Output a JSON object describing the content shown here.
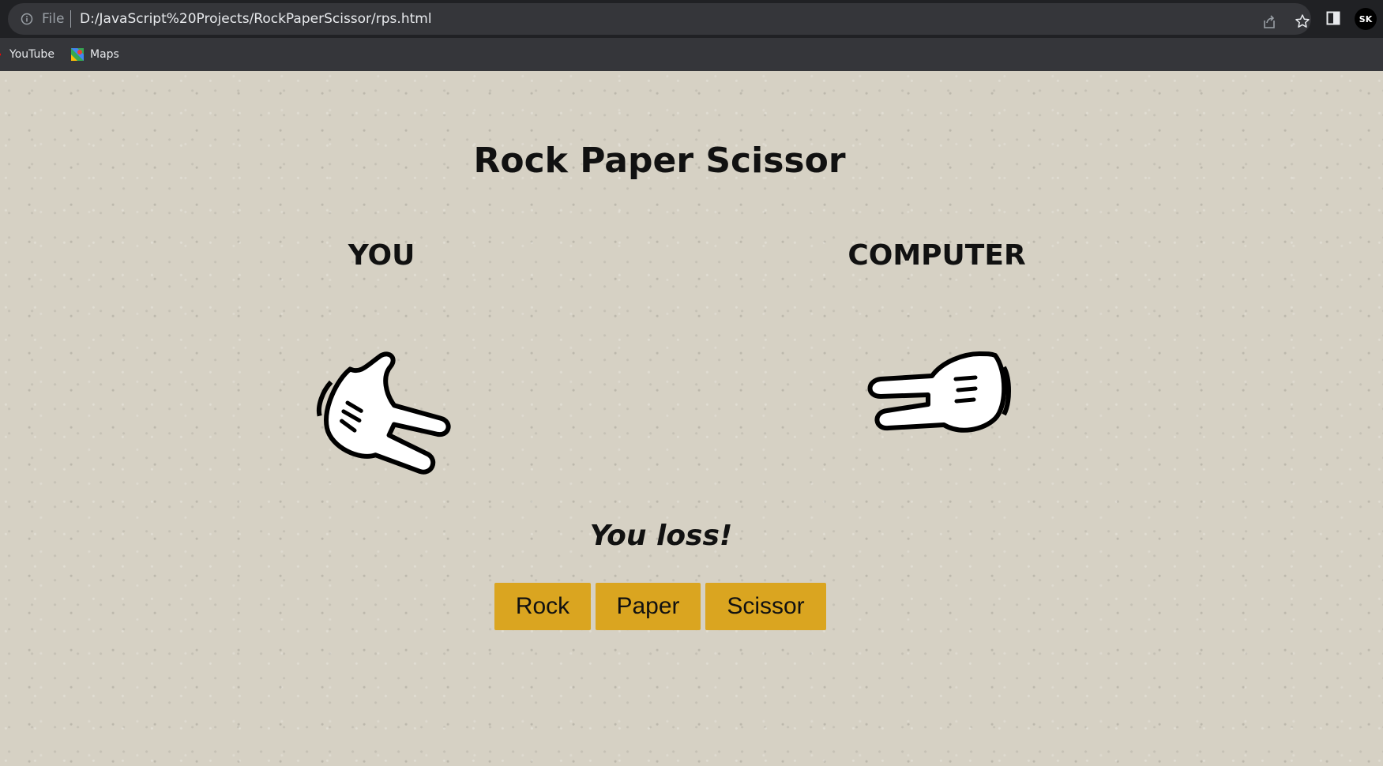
{
  "browser": {
    "file_label": "File",
    "url": "D:/JavaScript%20Projects/RockPaperScissor/rps.html",
    "profile_initials": "SK",
    "icons": [
      "info-icon",
      "share-icon",
      "star-icon",
      "side-panel-icon"
    ]
  },
  "bookmarks": {
    "items": [
      {
        "label": "YouTube",
        "icon": "youtube-icon"
      },
      {
        "label": "Maps",
        "icon": "maps-icon"
      }
    ]
  },
  "game": {
    "title": "Rock Paper Scissor",
    "you_label": "YOU",
    "computer_label": "COMPUTER",
    "you_choice_icon": "scissor-hand-icon",
    "computer_choice_icon": "scissor-hand-icon",
    "result": "You loss!",
    "buttons": {
      "rock": "Rock",
      "paper": "Paper",
      "scissor": "Scissor"
    },
    "colors": {
      "button_bg": "#daa520",
      "page_bg": "#d6d1c4"
    }
  }
}
